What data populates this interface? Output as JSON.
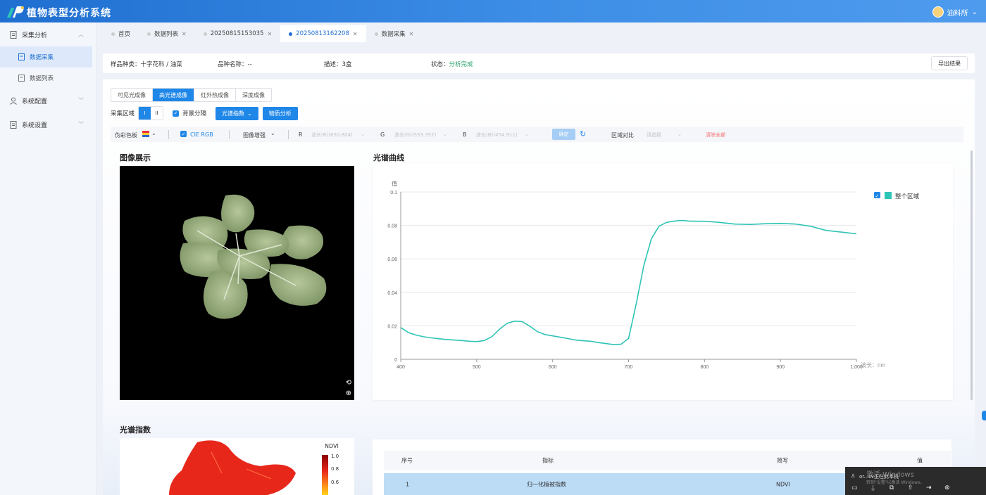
{
  "app": {
    "title": "植物表型分析系统"
  },
  "user": {
    "name": "油料所"
  },
  "sidebar": {
    "groups": [
      {
        "label": "采集分析",
        "children": [
          {
            "label": "数据采集"
          },
          {
            "label": "数据列表"
          }
        ]
      },
      {
        "label": "系统配置"
      },
      {
        "label": "系统设置"
      }
    ]
  },
  "tabs": [
    {
      "label": "首页"
    },
    {
      "label": "数据列表"
    },
    {
      "label": "20250815153035"
    },
    {
      "label": "20250813162208"
    },
    {
      "label": "数据采集"
    }
  ],
  "info": {
    "species": "样品种类：十字花科 / 油菜",
    "variety": "品种名称：--",
    "desc": "描述：3盒",
    "status_label": "状态：",
    "status_value": "分析完成",
    "export_label": "导出结果"
  },
  "modes": [
    "可见光成像",
    "高光谱成像",
    "红外热成像",
    "深度成像"
  ],
  "controls": {
    "region_label": "采集区域",
    "region_options": [
      "I",
      "II"
    ],
    "bg_sep_label": "背景分隔",
    "spectral_index_label": "光谱指数",
    "phenotype_label": "物质分析"
  },
  "toolbar": {
    "palette_label": "伪彩色板",
    "cie_label": "CIE RGB",
    "enhance_label": "图像增强",
    "r_label": "R",
    "r_value": "波长(R)(650.804)",
    "g_label": "G",
    "g_value": "波长(G)(553.357)",
    "b_label": "B",
    "b_value": "波长(B)(454.911)",
    "apply_label": "确定",
    "compare_label": "区域对比",
    "compare_placeholder": "请选择",
    "clear_label": "清除全部"
  },
  "sections": {
    "image_title": "图像展示",
    "curve_title": "光谱曲线",
    "index_title": "光谱指数"
  },
  "ndvi": {
    "label": "NDVI",
    "ticks": [
      "1.0",
      "0.8",
      "0.6"
    ]
  },
  "table": {
    "headers": [
      "序号",
      "指标",
      "简写",
      "值"
    ],
    "rows": [
      {
        "no": "1",
        "name": "归一化植被指数",
        "abbr": "NDVI",
        "value": ""
      }
    ]
  },
  "popup": {
    "watermark": "激活 Windows",
    "line1": "or...sv正在此本机",
    "line2": "转到\"设置\"以激活 Windows。"
  },
  "chart_data": {
    "type": "line",
    "title": "",
    "xlabel": "波长：nm",
    "ylabel": "值",
    "xlim": [
      400,
      1000
    ],
    "ylim": [
      0,
      0.1
    ],
    "xticks": [
      "400",
      "500",
      "600",
      "700",
      "800",
      "900",
      "1,000"
    ],
    "yticks": [
      "0",
      "0.02",
      "0.04",
      "0.06",
      "0.08",
      "0.1"
    ],
    "grid": true,
    "legend_position": "top-right",
    "series": [
      {
        "name": "整个区域",
        "color": "#2ec4b6",
        "x": [
          400,
          410,
          420,
          430,
          440,
          450,
          460,
          470,
          480,
          490,
          500,
          510,
          520,
          530,
          540,
          550,
          560,
          570,
          580,
          590,
          600,
          610,
          620,
          630,
          640,
          650,
          660,
          670,
          680,
          690,
          700,
          710,
          720,
          730,
          740,
          750,
          760,
          770,
          780,
          790,
          800,
          820,
          840,
          860,
          880,
          900,
          920,
          940,
          960,
          980,
          1000
        ],
        "y": [
          0.019,
          0.016,
          0.0145,
          0.0135,
          0.0128,
          0.0123,
          0.0118,
          0.0115,
          0.0112,
          0.0108,
          0.0106,
          0.0112,
          0.0135,
          0.018,
          0.0215,
          0.0228,
          0.0225,
          0.0198,
          0.0165,
          0.0148,
          0.014,
          0.0132,
          0.0124,
          0.0115,
          0.0111,
          0.0108,
          0.01,
          0.0094,
          0.0088,
          0.009,
          0.0125,
          0.033,
          0.056,
          0.072,
          0.0795,
          0.0818,
          0.0826,
          0.083,
          0.0826,
          0.0825,
          0.0825,
          0.0818,
          0.0808,
          0.0806,
          0.081,
          0.0812,
          0.0808,
          0.0795,
          0.077,
          0.076,
          0.075
        ]
      }
    ]
  }
}
